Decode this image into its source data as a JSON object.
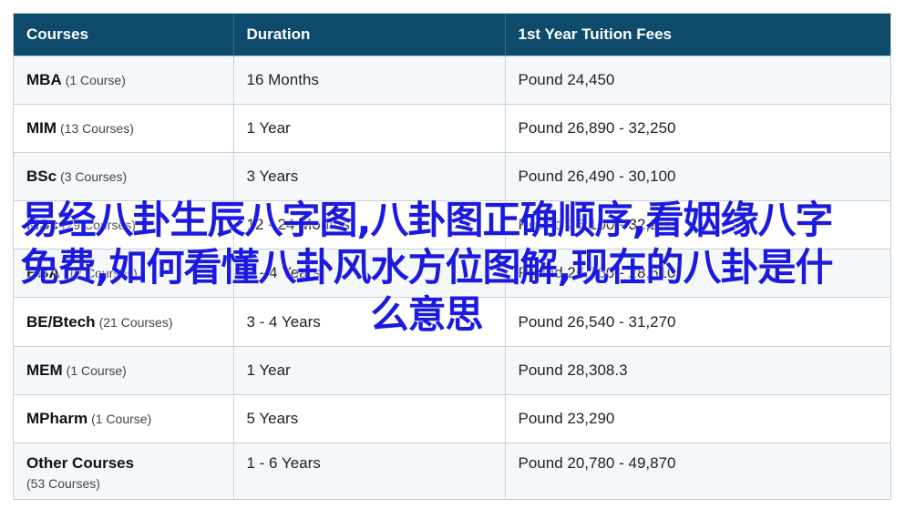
{
  "table": {
    "headers": [
      "Courses",
      "Duration",
      "1st Year Tuition Fees"
    ],
    "rows": [
      {
        "name": "MBA",
        "count": "(1 Course)",
        "duration": "16 Months",
        "fees": "Pound 24,450"
      },
      {
        "name": "MIM",
        "count": "(13 Courses)",
        "duration": "1 Year",
        "fees": "Pound 26,890 - 32,250"
      },
      {
        "name": "BSc",
        "count": "(3 Courses)",
        "duration": "3 Years",
        "fees": "Pound 26,490 - 30,100"
      },
      {
        "name": "MSc",
        "count": "(29 Courses)",
        "duration": "12 - 24 Months",
        "fees": "Pound 26,100 - 32,250"
      },
      {
        "name": "BBA",
        "count": "(12 Courses)",
        "duration": "3 - 4 Years",
        "fees": "Pound 26,260 - 28,610"
      },
      {
        "name": "BE/Btech",
        "count": "(21 Courses)",
        "duration": "3 - 4 Years",
        "fees": "Pound 26,540 - 31,270"
      },
      {
        "name": "MEM",
        "count": "(1 Course)",
        "duration": "1 Year",
        "fees": "Pound 28,308.3"
      },
      {
        "name": "MPharm",
        "count": "(1 Course)",
        "duration": "5 Years",
        "fees": "Pound 23,290"
      },
      {
        "name": "Other Courses",
        "count": "(53 Courses)",
        "duration": "1 - 6 Years",
        "fees": "Pound 20,780 - 49,870"
      }
    ]
  },
  "overlay": {
    "text": "易经八卦生辰八字图,八卦图正确顺序,看姻缘八字免费,如何看懂八卦风水方位图解,现在的八卦是什么意思"
  }
}
